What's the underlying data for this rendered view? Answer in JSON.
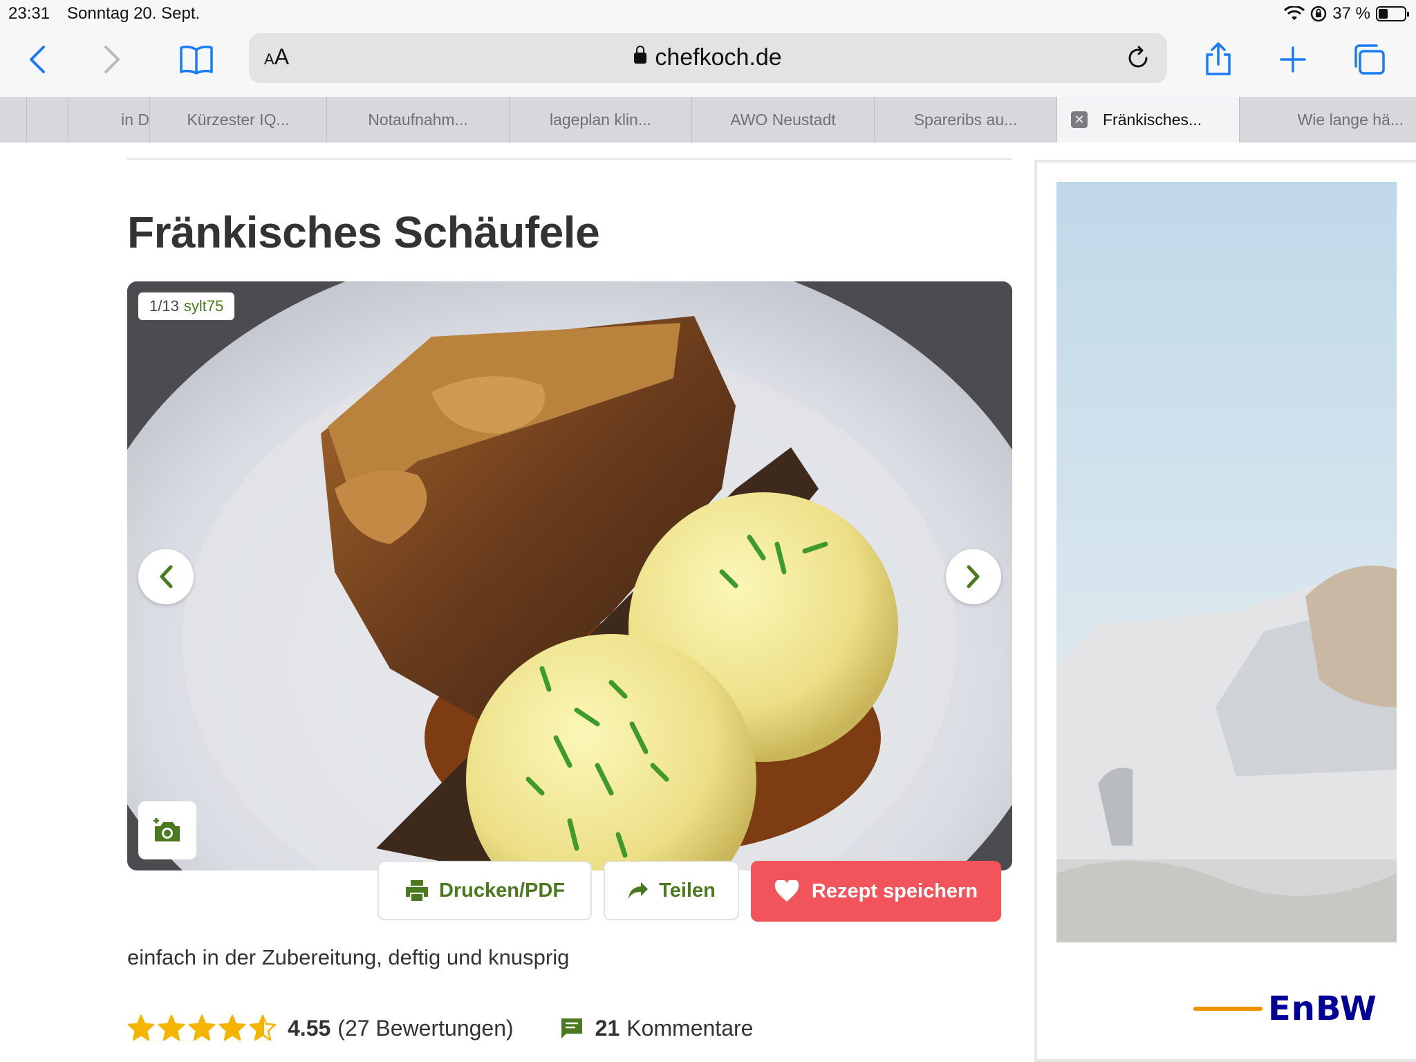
{
  "status": {
    "time": "23:31",
    "date": "Sonntag 20. Sept.",
    "battery_percent": "37 %",
    "battery_level": 0.37
  },
  "toolbar": {
    "reader_label": "A",
    "reader_label_large": "A",
    "domain": "chefkoch.de"
  },
  "tabs": [
    {
      "label": ""
    },
    {
      "label": "in D"
    },
    {
      "label": "Kürzester IQ..."
    },
    {
      "label": "Notaufnahm..."
    },
    {
      "label": "lageplan klin..."
    },
    {
      "label": "AWO Neustadt"
    },
    {
      "label": "Spareribs au..."
    },
    {
      "label": "Fränkisches..."
    },
    {
      "label": "Wie lange hä..."
    }
  ],
  "recipe": {
    "title": "Fränkisches Schäufele",
    "gallery_counter": "1/13",
    "gallery_author": "sylt75",
    "print_label": "Drucken/PDF",
    "share_label": "Teilen",
    "save_label": "Rezept speichern",
    "subtitle": "einfach in der Zubereitung, deftig und knusprig",
    "rating_score": "4.55",
    "rating_count": "(27 Bewertungen)",
    "rating_value": 4.55,
    "comments_count": "21",
    "comments_label": "Kommentare"
  },
  "ad": {
    "brand": "EnBW"
  },
  "colors": {
    "ios_blue": "#1a7cf5",
    "chefkoch_green": "#4b7a1e",
    "save_red": "#f2545b",
    "star_gold": "#f4b400",
    "enbw_blue": "#000099",
    "enbw_orange": "#f39200"
  }
}
